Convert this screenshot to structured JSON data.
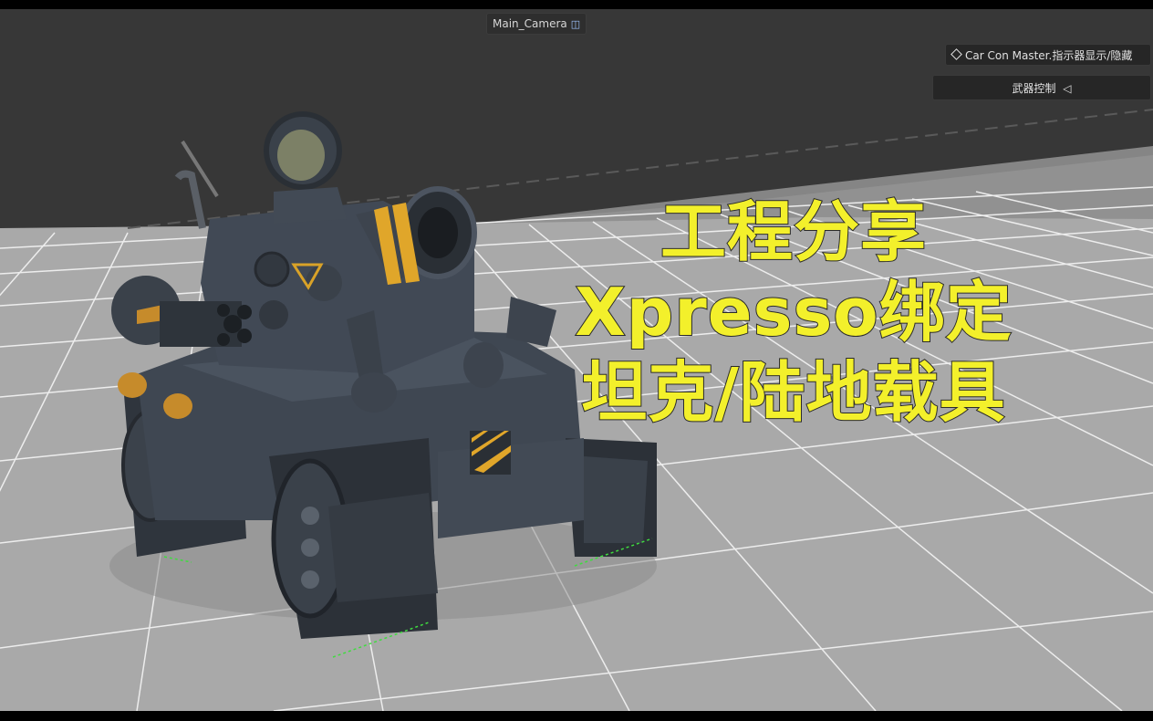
{
  "viewport": {
    "camera_label": "Main_Camera",
    "camera_icon": "camera-icon",
    "background_color": "#3a3a3a",
    "grid_floor_color": "#a8a8a8"
  },
  "hud": {
    "toggle_indicator_label": "Car Con Master.指示器显示/隐藏",
    "toggle_icon": "diamond-icon",
    "weapon_control_label": "武器控制",
    "weapon_control_icon": "triangle-left-icon"
  },
  "overlay_title": {
    "line1": "工程分享",
    "line2": "Xpresso绑定",
    "line3": "坦克/陆地载具",
    "color": "#f3f02b"
  },
  "scene_object": {
    "icon": "tank-model",
    "body_color": "#3f4752",
    "hazard_stripe_color": "#e0a62a"
  }
}
